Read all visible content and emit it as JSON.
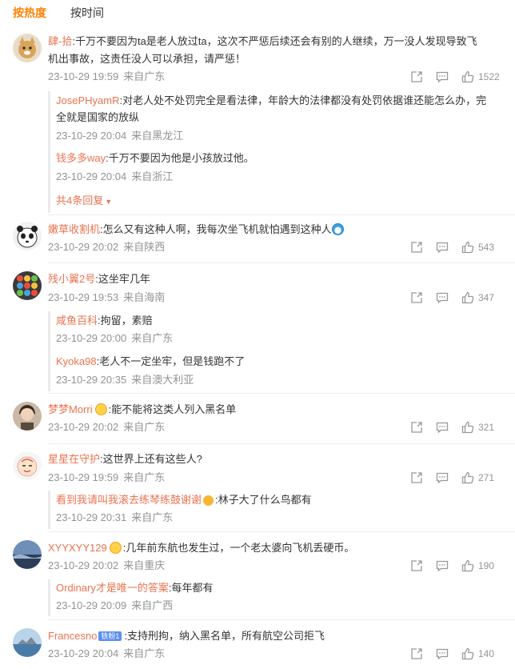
{
  "tabs": {
    "hot": "按热度",
    "time": "按时间"
  },
  "colors": {
    "accent": "#ff8200",
    "username": "#eb7350",
    "meta": "#939393"
  },
  "comments": [
    {
      "user": "肆-拾",
      "text_line1": ":千万不要因为ta是老人放过ta，这次不严惩后续还会有别的人继续，万一没人发现导致飞",
      "text_line2": "机出事故，这责任没人可以承担，请严惩！",
      "time": "23-10-29 19:59",
      "location": "来自广东",
      "likes": "1522",
      "replies": [
        {
          "user": "JosePHyamR",
          "text_line1": ":对老人处不处罚完全是看法律，年龄大的法律都没有处罚依据谁还能怎么办，完",
          "text_line2": "全就是国家的放纵",
          "time": "23-10-29 20:04",
          "location": "来自黑龙江"
        },
        {
          "user": "钱多多way",
          "text_line1": ":千万不要因为他是小孩放过他。",
          "time": "23-10-29 20:04",
          "location": "来自浙江"
        }
      ],
      "more_replies": "共4条回复"
    },
    {
      "user": "嫩草收割机",
      "text_line1": ":怎么又有这种人啊，我每次坐飞机就怕遇到这种人",
      "time": "23-10-29 20:02",
      "location": "来自陕西",
      "likes": "543"
    },
    {
      "user": "残小翼2号",
      "text_line1": ":这坐牢几年",
      "time": "23-10-29 19:53",
      "location": "来自海南",
      "likes": "347",
      "replies": [
        {
          "user": "咸鱼百科",
          "text_line1": ":拘留，素赔",
          "time": "23-10-29 20:00",
          "location": "来自广东"
        },
        {
          "user": "Kyoka98",
          "text_line1": ":老人不一定坐牢，但是钱跑不了",
          "time": "23-10-29 20:35",
          "location": "来自澳大利亚"
        }
      ]
    },
    {
      "user": "梦梦Morri",
      "text_line1": ":能不能将这类人列入黑名单",
      "time": "23-10-29 20:02",
      "location": "来自广东",
      "likes": "321"
    },
    {
      "user": "星星在守护",
      "text_line1": ":这世界上还有这些人?",
      "time": "23-10-29 19:59",
      "location": "来自广东",
      "likes": "271",
      "replies": [
        {
          "user": "看到我请叫我滚去练琴练鼓谢谢",
          "text_line1": ":林子大了什么鸟都有",
          "time": "23-10-29 20:31",
          "location": "来自广东"
        }
      ]
    },
    {
      "user": "XYYXYY129",
      "text_line1": ":几年前东航也发生过，一个老太婆向飞机丢硬币。",
      "time": "23-10-29 20:02",
      "location": "来自重庆",
      "likes": "190",
      "replies": [
        {
          "user": "Ordinary才是唯一的答案",
          "text_line1": ":每年都有",
          "time": "23-10-29 20:09",
          "location": "来自广西"
        }
      ]
    },
    {
      "user": "Francesno",
      "vip": "铁粉1",
      "text_line1": ":支持刑拘，纳入黑名单，所有航空公司拒飞",
      "time": "23-10-29 20:04",
      "location": "来自广东",
      "likes": "140"
    }
  ]
}
